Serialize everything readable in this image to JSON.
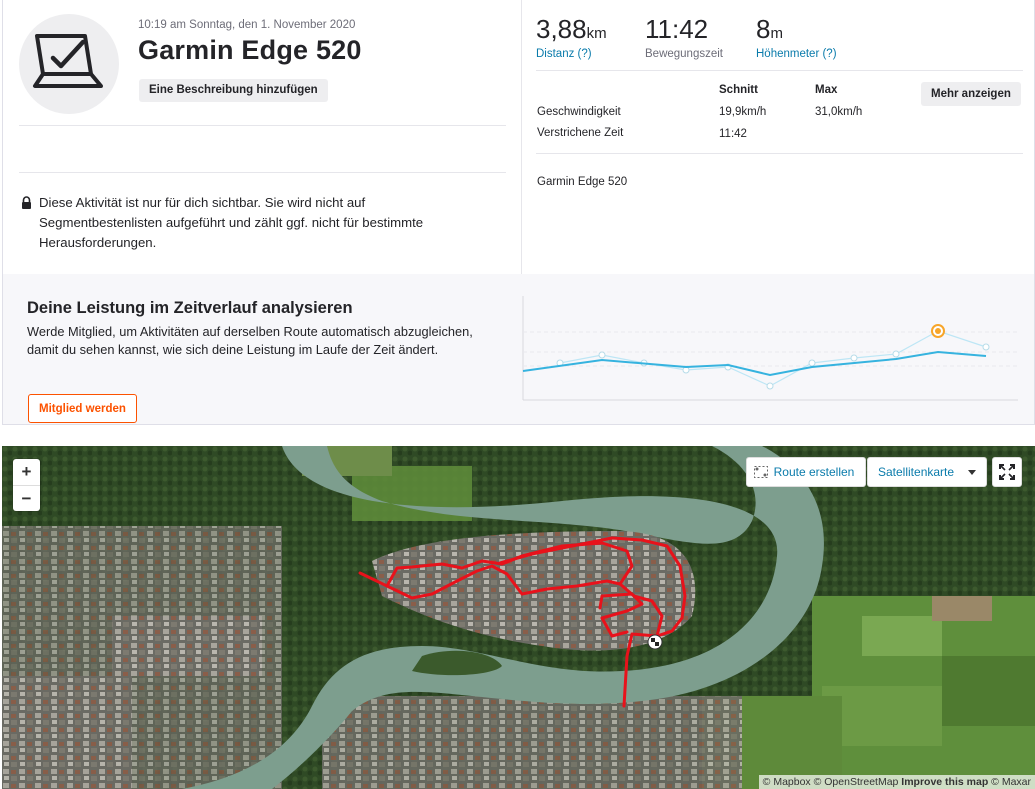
{
  "activity": {
    "datetime": "10:19 am Sonntag, den 1. November 2020",
    "title": "Garmin Edge 520",
    "add_description": "Eine Beschreibung hinzufügen",
    "privacy_notice": "Diese Aktivität ist nur für dich sichtbar. Sie wird nicht auf Segmentbestenlisten aufgeführt und zählt ggf. nicht für bestimmte Herausforderungen.",
    "device": "Garmin Edge 520"
  },
  "stats": {
    "distance": {
      "value": "3,88",
      "unit": "km",
      "label": "Distanz (?)"
    },
    "moving_time": {
      "value": "11:42",
      "label": "Bewegungszeit"
    },
    "elevation": {
      "value": "8",
      "unit": "m",
      "label": "Höhenmeter (?)"
    }
  },
  "details": {
    "headers": {
      "avg": "Schnitt",
      "max": "Max"
    },
    "rows": [
      {
        "label": "Geschwindigkeit",
        "avg": "19,9km/h",
        "max": "31,0km/h"
      },
      {
        "label": "Verstrichene Zeit",
        "avg": "11:42",
        "max": ""
      }
    ],
    "more_button": "Mehr anzeigen"
  },
  "performance": {
    "title": "Deine Leistung im Zeitverlauf analysieren",
    "text": "Werde Mitglied, um Aktivitäten auf derselben Route automatisch abzugleichen, damit du sehen kannst, wie sich deine Leistung im Laufe der Zeit ändert.",
    "cta": "Mitglied werden"
  },
  "map": {
    "zoom_in": "+",
    "zoom_out": "−",
    "create_route": "Route erstellen",
    "map_type": "Satellitenkarte",
    "attribution_plain_1": "© Mapbox © OpenStreetMap ",
    "attribution_bold": "Improve this map",
    "attribution_plain_2": " © Maxar"
  },
  "colors": {
    "brand": "#fc5200",
    "link": "#0a7bab",
    "route": "#e8121b",
    "trend": "#36b3df"
  }
}
